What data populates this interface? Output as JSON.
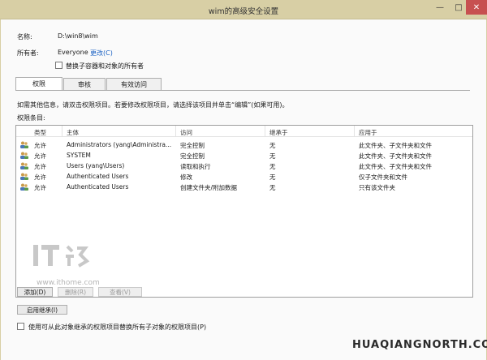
{
  "window": {
    "title": "wim的高级安全设置",
    "min_glyph": "—",
    "max_glyph": "□",
    "close_glyph": "✕"
  },
  "props": {
    "name_label": "名称:",
    "name_value": "D:\\win8\\wim",
    "owner_label": "所有者:",
    "owner_value": "Everyone",
    "change_link": "更改(C)",
    "replace_owner_label": "替换子容器和对象的所有者"
  },
  "tabs": [
    {
      "label": "权限"
    },
    {
      "label": "审核"
    },
    {
      "label": "有效访问"
    }
  ],
  "info_text": "如需其他信息，请双击权限项目。若要修改权限项目，请选择该项目并单击“编辑”(如果可用)。",
  "entries_label": "权限条目:",
  "table": {
    "headers": [
      "类型",
      "主体",
      "访问",
      "继承于",
      "应用于"
    ],
    "rows": [
      [
        "允许",
        "Administrators (yang\\Administra...",
        "完全控制",
        "无",
        "此文件夹、子文件夹和文件"
      ],
      [
        "允许",
        "SYSTEM",
        "完全控制",
        "无",
        "此文件夹、子文件夹和文件"
      ],
      [
        "允许",
        "Users (yang\\Users)",
        "读取和执行",
        "无",
        "此文件夹、子文件夹和文件"
      ],
      [
        "允许",
        "Authenticated Users",
        "修改",
        "无",
        "仅子文件夹和文件"
      ],
      [
        "允许",
        "Authenticated Users",
        "创建文件夹/附加数据",
        "无",
        "只有该文件夹"
      ]
    ]
  },
  "buttons": {
    "add": "添加(D)",
    "remove": "删除(R)",
    "view": "查看(V)",
    "enable_inheritance": "启用继承(I)"
  },
  "replace_child_label": "使用可从此对象继承的权限项目替换所有子对象的权限项目(P)",
  "watermark": {
    "url": "www.ithome.com",
    "bottom_brand": "HUAQIANGNORTH.COM"
  },
  "colors": {
    "titlebar": "#d8cfa5",
    "close": "#c75050",
    "link": "#1c63c4"
  }
}
